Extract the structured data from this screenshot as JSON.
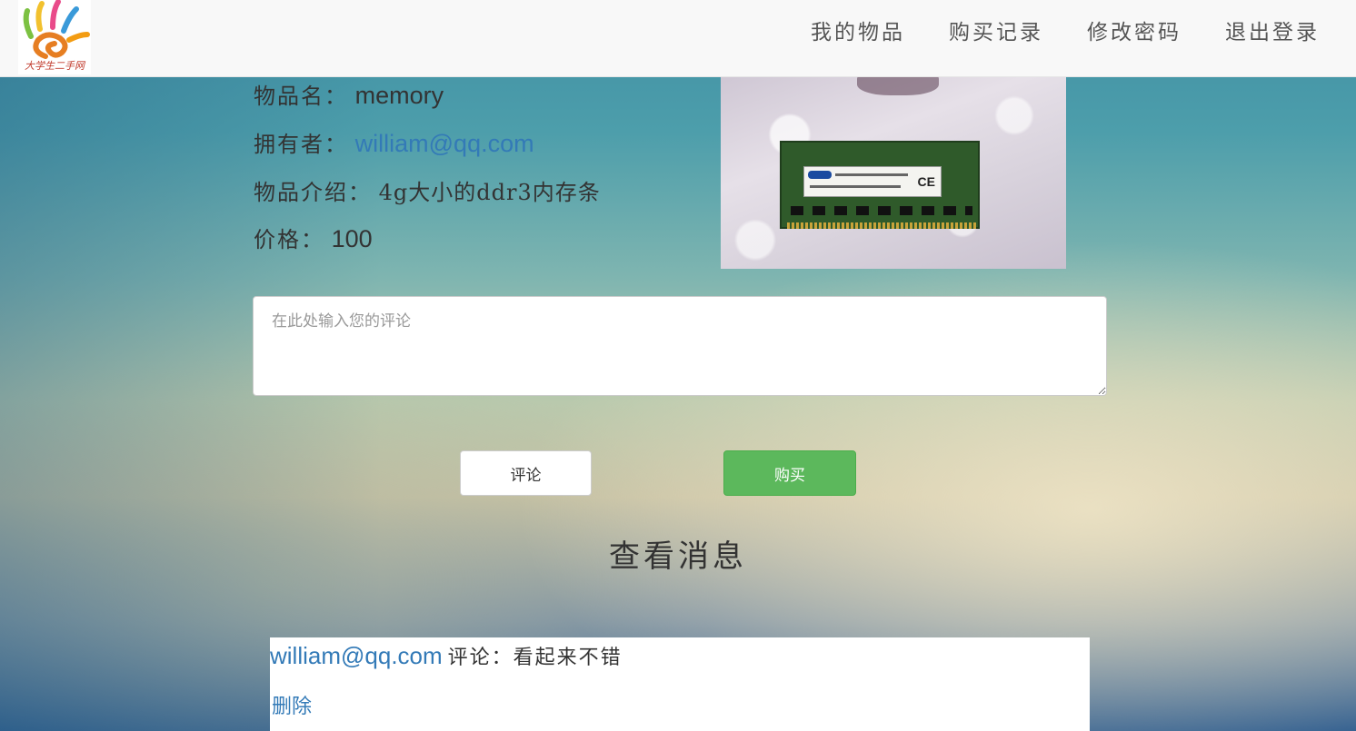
{
  "navbar": {
    "logo_caption": "大学生二手网",
    "links": [
      "我的物品",
      "购买记录",
      "修改密码",
      "退出登录"
    ]
  },
  "item": {
    "name_label": "物品名：",
    "name": "memory",
    "owner_label": "拥有者：",
    "owner": "william@qq.com",
    "desc_label": "物品介绍：",
    "desc": "4g大小的ddr3内存条",
    "price_label": "价格：",
    "price": "100"
  },
  "comment_form": {
    "placeholder": "在此处输入您的评论",
    "comment_button": "评论",
    "buy_button": "购买"
  },
  "messages": {
    "title": "查看消息",
    "items": [
      {
        "user": "william@qq.com",
        "label": "评论：",
        "text": "看起来不错",
        "delete": "删除"
      }
    ]
  },
  "colors": {
    "link": "#337ab7",
    "buy_button": "#5cb85c"
  }
}
